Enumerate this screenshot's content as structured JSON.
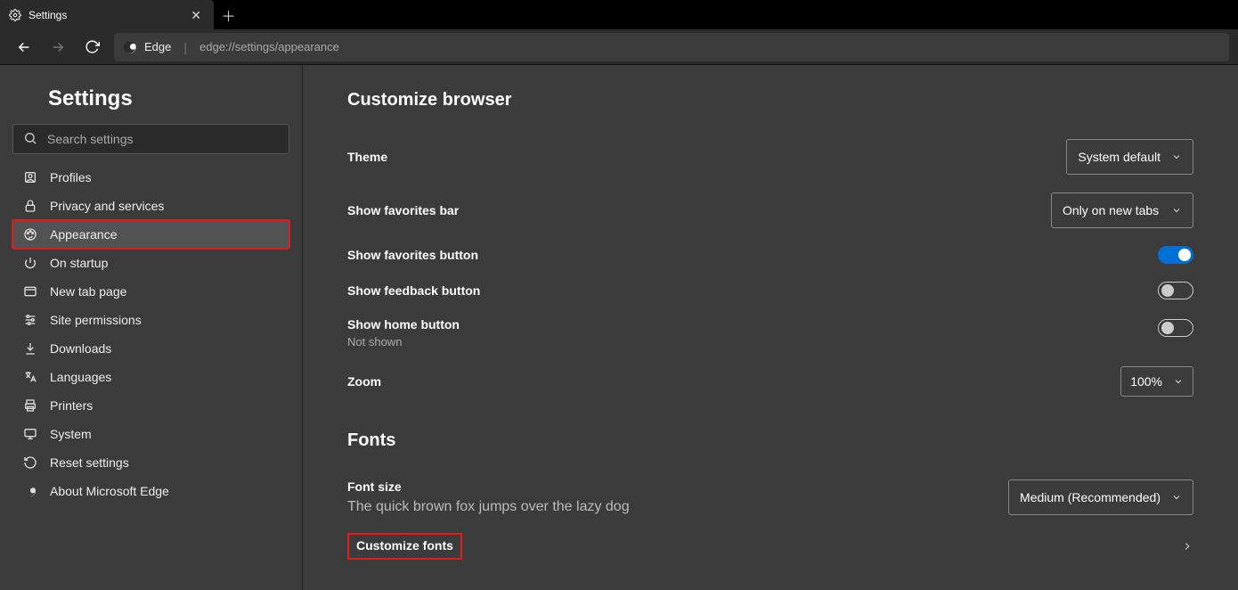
{
  "tab": {
    "title": "Settings"
  },
  "toolbar": {
    "label": "Edge",
    "url": "edge://settings/appearance"
  },
  "sidebar": {
    "title": "Settings",
    "search_placeholder": "Search settings",
    "items": [
      {
        "label": "Profiles"
      },
      {
        "label": "Privacy and services"
      },
      {
        "label": "Appearance"
      },
      {
        "label": "On startup"
      },
      {
        "label": "New tab page"
      },
      {
        "label": "Site permissions"
      },
      {
        "label": "Downloads"
      },
      {
        "label": "Languages"
      },
      {
        "label": "Printers"
      },
      {
        "label": "System"
      },
      {
        "label": "Reset settings"
      },
      {
        "label": "About Microsoft Edge"
      }
    ]
  },
  "main": {
    "customize_title": "Customize browser",
    "theme": {
      "label": "Theme",
      "value": "System default"
    },
    "fav_bar": {
      "label": "Show favorites bar",
      "value": "Only on new tabs"
    },
    "fav_button": {
      "label": "Show favorites button",
      "on": true
    },
    "feedback": {
      "label": "Show feedback button",
      "on": false
    },
    "home": {
      "label": "Show home button",
      "sub": "Not shown",
      "on": false
    },
    "zoom": {
      "label": "Zoom",
      "value": "100%"
    },
    "fonts_title": "Fonts",
    "font_size": {
      "label": "Font size",
      "value": "Medium (Recommended)",
      "sample": "The quick brown fox jumps over the lazy dog"
    },
    "customize_fonts": {
      "label": "Customize fonts"
    }
  }
}
